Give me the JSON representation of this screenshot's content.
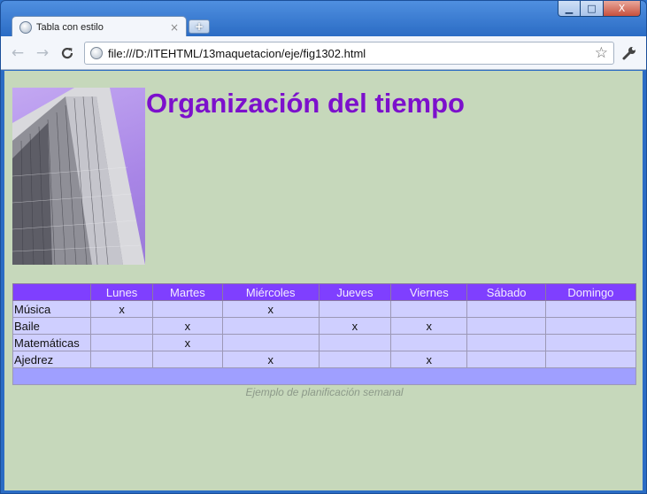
{
  "browser": {
    "tab_title": "Tabla con estilo",
    "tab_close": "×",
    "new_tab": "+",
    "back_icon": "←",
    "forward_icon": "→",
    "reload_icon": "C",
    "url": "file:///D:/ITEHTML/13maquetacion/eje/fig1302.html",
    "bookmark_icon": "☆",
    "wrench_icon": "🔧",
    "minimize": "▁",
    "maximize": "□",
    "close": "X"
  },
  "page": {
    "title": "Organización del tiempo",
    "caption": "Ejemplo de planificación semanal"
  },
  "table": {
    "corner": "",
    "days": [
      "Lunes",
      "Martes",
      "Miércoles",
      "Jueves",
      "Viernes",
      "Sábado",
      "Domingo"
    ],
    "rows": [
      {
        "label": "Música",
        "cells": [
          "x",
          "",
          "x",
          "",
          "",
          "",
          ""
        ]
      },
      {
        "label": "Baile",
        "cells": [
          "",
          "x",
          "",
          "x",
          "x",
          "",
          ""
        ]
      },
      {
        "label": "Matemáticas",
        "cells": [
          "",
          "x",
          "",
          "",
          "",
          "",
          ""
        ]
      },
      {
        "label": "Ajedrez",
        "cells": [
          "",
          "",
          "x",
          "",
          "x",
          "",
          ""
        ]
      }
    ]
  },
  "colors": {
    "page_background": "#c6d8bb",
    "title": "#7c10cc",
    "header_row": "#7f3fff",
    "body_cells": "#cfcfff",
    "footer_row": "#9f9fff"
  }
}
